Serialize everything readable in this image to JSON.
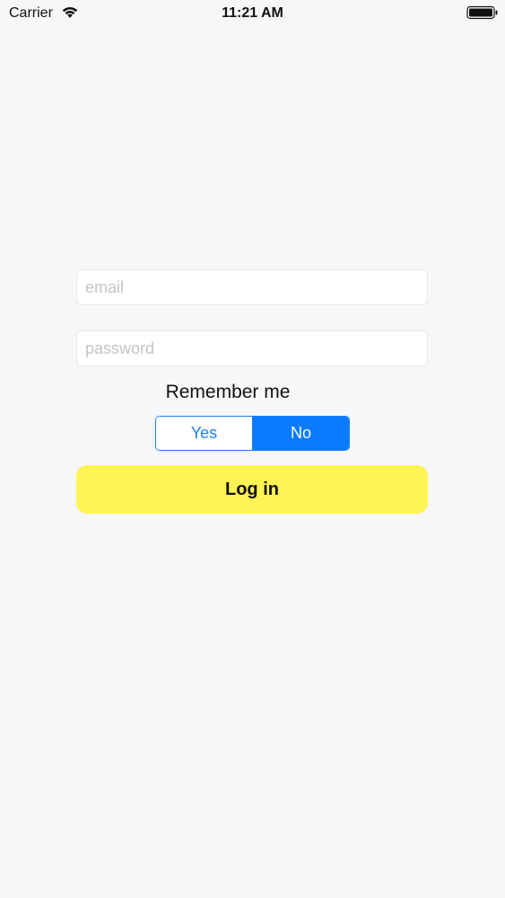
{
  "status_bar": {
    "carrier": "Carrier",
    "time": "11:21 AM",
    "wifi_icon": "wifi-icon",
    "battery_icon": "battery-icon"
  },
  "form": {
    "email": {
      "value": "",
      "placeholder": "email"
    },
    "password": {
      "value": "",
      "placeholder": "password"
    },
    "remember_label": "Remember me",
    "remember_options": [
      "Yes",
      "No"
    ],
    "remember_selected": "No",
    "login_label": "Log in"
  },
  "colors": {
    "background": "#f6f7f9",
    "accent": "#0a7aff",
    "login_button": "#fff454"
  }
}
